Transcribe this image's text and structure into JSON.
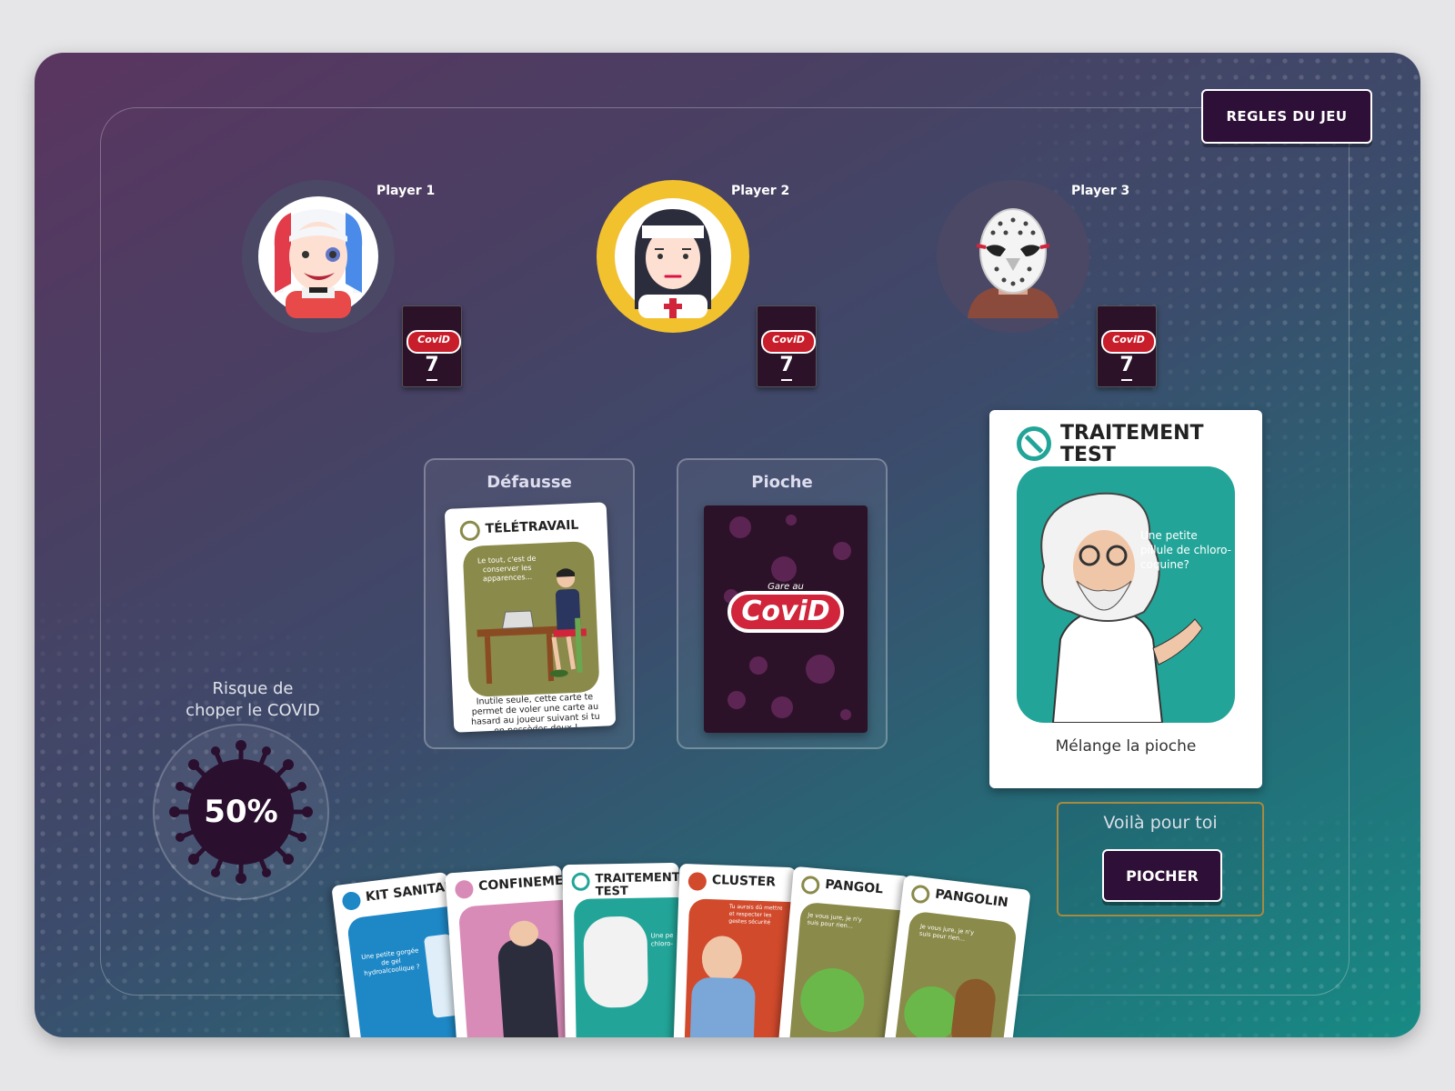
{
  "rules_button": "REGLES DU JEU",
  "players": [
    {
      "name": "Player 1",
      "cards": "7",
      "avatar": "harlequin-avatar",
      "logo": "CoviD"
    },
    {
      "name": "Player 2",
      "cards": "7",
      "avatar": "nun-avatar",
      "logo": "CoviD"
    },
    {
      "name": "Player 3",
      "cards": "7",
      "avatar": "hockey-mask-avatar",
      "logo": "CoviD"
    }
  ],
  "discard": {
    "label": "Défausse",
    "card_title": "TÉLÉTRAVAIL",
    "quote": "Le tout, c'est de conserver les apparences...",
    "text": "Inutile seule, cette carte te permet de voler une carte au hasard au joueur suivant si tu en possèdes deux !"
  },
  "draw_pile": {
    "label": "Pioche",
    "logo_small": "Gare au",
    "logo": "CoviD"
  },
  "current_card": {
    "title_line1": "TRAITEMENT",
    "title_line2": "TEST",
    "quote": "Une petite pillule de chloro-coquine?",
    "action": "Mélange la pioche"
  },
  "risk": {
    "label_line1": "Risque de",
    "label_line2": "choper le COVID",
    "value": "50%"
  },
  "gift": {
    "label": "Voilà pour toi",
    "button": "PIOCHER"
  },
  "hand": [
    {
      "title": "KIT SANITAI",
      "quote": "Une petite gorgée de gel hydroalcoolique ?",
      "color": "#1e88c7",
      "icon": "syringe-icon"
    },
    {
      "title": "CONFINEME",
      "quote": "",
      "color": "#d98bb8",
      "icon": "house-icon"
    },
    {
      "title_line1": "TRAITEMENT",
      "title_line2": "TEST",
      "quote": "Une pe chloro-",
      "color": "#22a598",
      "icon": "no-entry-icon"
    },
    {
      "title": "CLUSTER",
      "quote": "Tu aurais dû mettre et respecter les gestes sécurité",
      "color": "#d24a2c",
      "icon": "exclamation-icon"
    },
    {
      "title": "PANGOL",
      "quote": "Je vous jure, je n'y suis pour rien...",
      "color": "#8a8a4a",
      "icon": "cards-icon"
    },
    {
      "title": "PANGOLIN",
      "quote": "Je vous jure, je n'y suis pour rien...",
      "color": "#8a8a4a",
      "icon": "cards-icon"
    }
  ],
  "colors": {
    "accent_button": "#2e0f37",
    "teal_card": "#22a598",
    "olive_card": "#8a8a4a",
    "virus": "#2a0f2e",
    "gift_border": "#a58a42"
  }
}
